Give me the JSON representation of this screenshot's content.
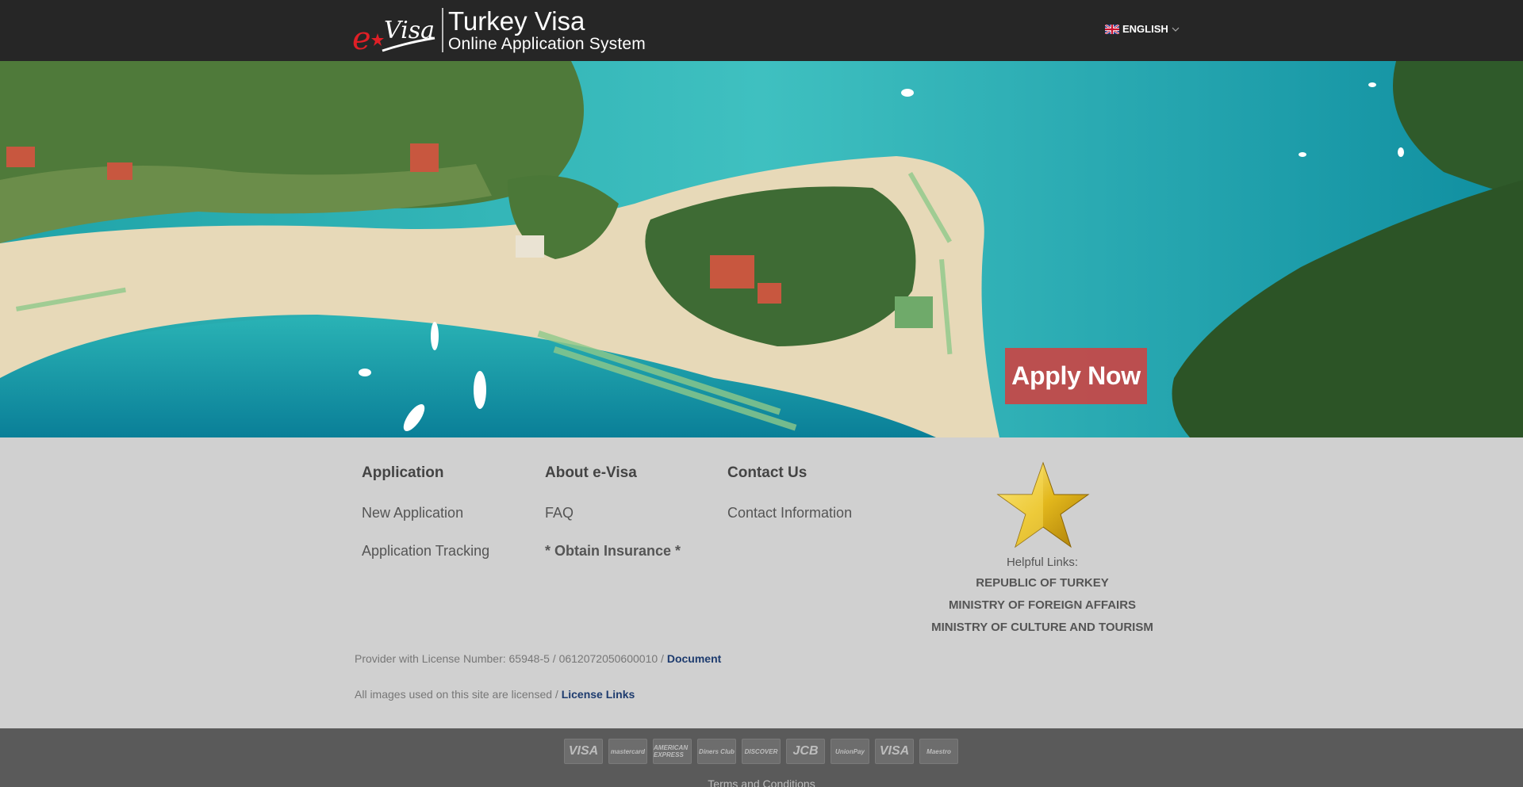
{
  "header": {
    "logo_text": "eVisa",
    "title": "Turkey Visa",
    "subtitle": "Online Application System",
    "language": "ENGLISH",
    "language_icon": "uk-flag-icon"
  },
  "hero": {
    "apply_label": "Apply Now"
  },
  "footer": {
    "columns": [
      {
        "title": "Application",
        "links": [
          "New Application",
          "Application Tracking"
        ]
      },
      {
        "title": "About e-Visa",
        "links": [
          "FAQ",
          "* Obtain Insurance *"
        ]
      },
      {
        "title": "Contact Us",
        "links": [
          "Contact Information"
        ]
      }
    ],
    "helpful": {
      "label": "Helpful Links:",
      "links": [
        "REPUBLIC OF TURKEY",
        "MINISTRY OF FOREIGN AFFAIRS",
        "MINISTRY OF CULTURE AND TOURISM"
      ]
    },
    "license_line": "Provider with License Number: 65948-5 / 0612072050600010 /",
    "license_link": "Document",
    "images_line": "All images used on this site are licensed /",
    "images_link": "License Links"
  },
  "bottom": {
    "cards": [
      "VISA",
      "mastercard",
      "AMERICAN EXPRESS",
      "Diners Club",
      "DISCOVER",
      "JCB",
      "UnionPay",
      "VISA",
      "Maestro"
    ],
    "terms": "Terms and Conditions"
  },
  "colors": {
    "header_bg": "#262626",
    "footer_bg": "#d0d0d0",
    "bottom_bg": "#5a5a5a",
    "apply_bg": "#c84646",
    "link_accent": "#1d3b6e"
  }
}
